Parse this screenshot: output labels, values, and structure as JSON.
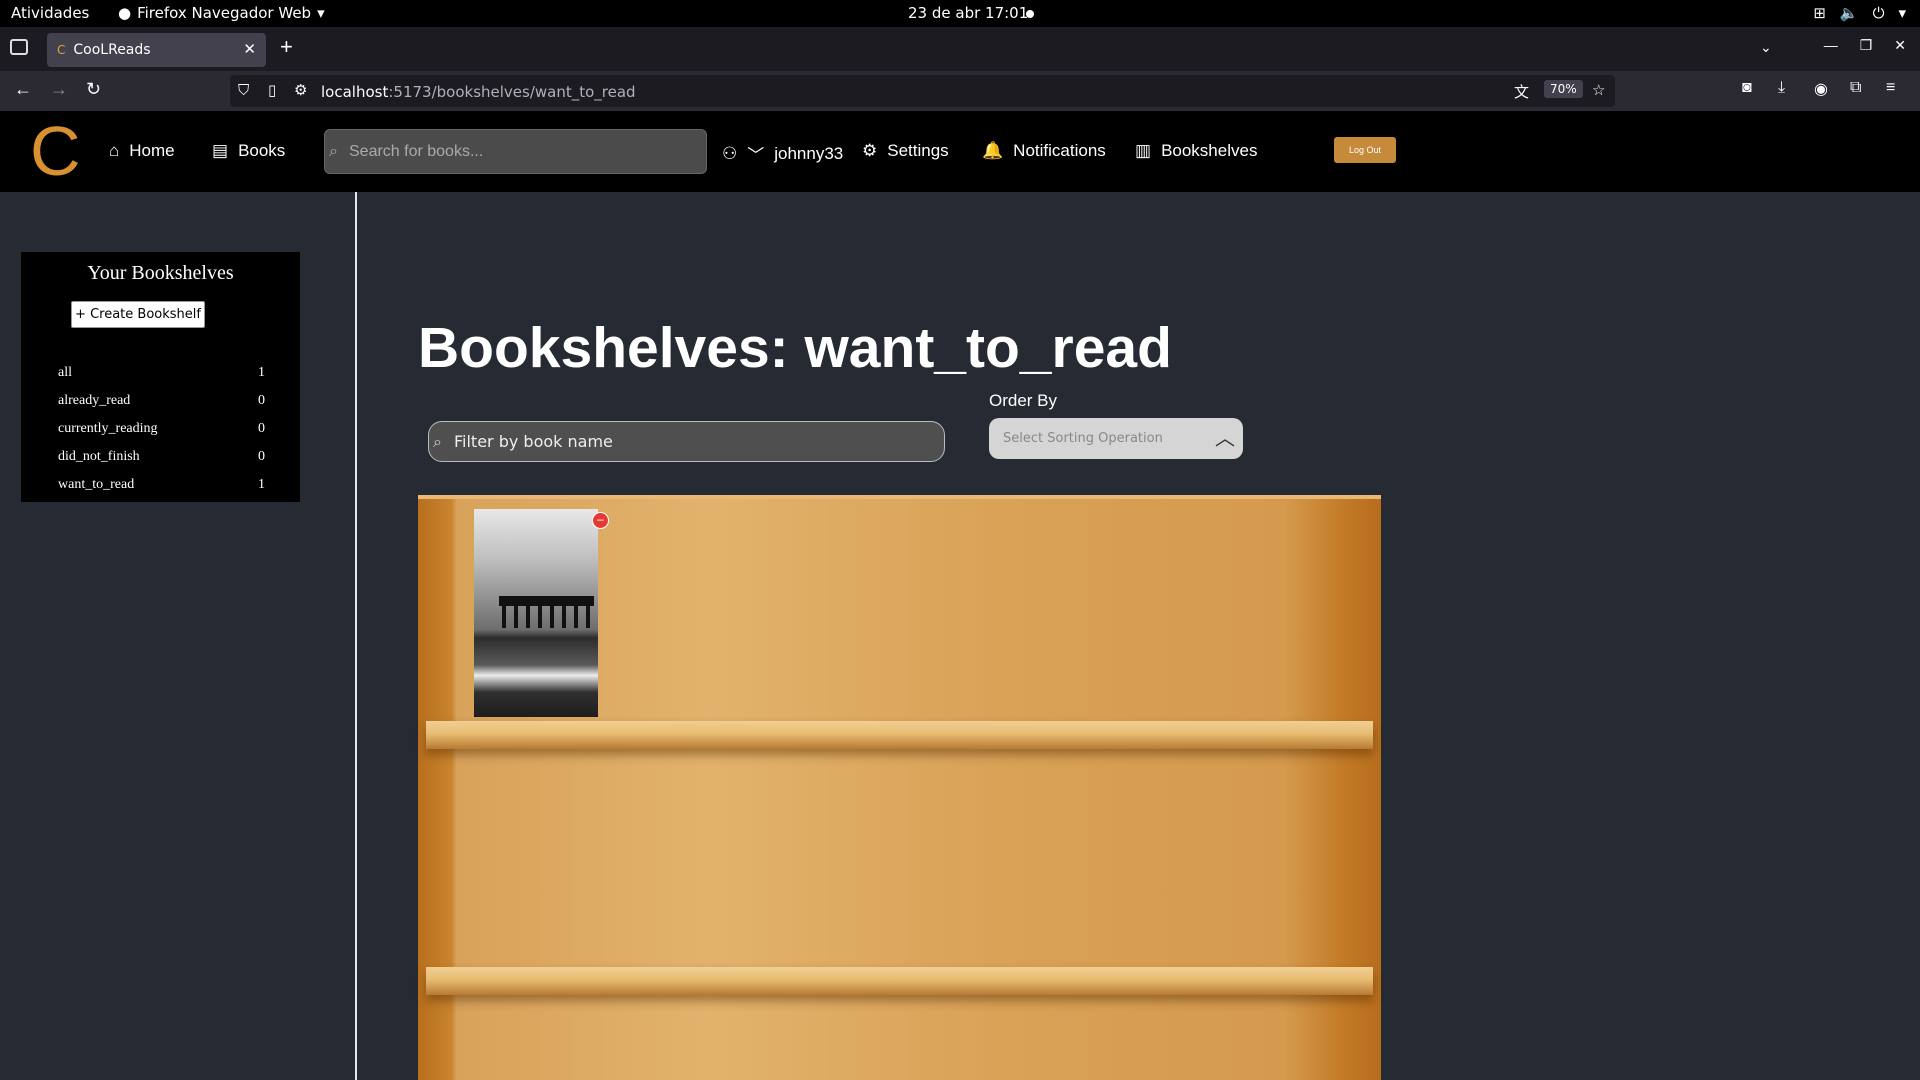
{
  "os_bar": {
    "activities": "Atividades",
    "app_name": "Firefox Navegador Web",
    "clock": "23 de abr  17:01"
  },
  "browser": {
    "tab_title": "CooLReads",
    "url_host": "localhost",
    "url_rest": ":5173/bookshelves/want_to_read",
    "zoom": "70%"
  },
  "header": {
    "logo": "C",
    "home": "Home",
    "books": "Books",
    "search_placeholder": "Search for books...",
    "username": "johnny33",
    "settings": "Settings",
    "notifications": "Notifications",
    "bookshelves": "Bookshelves",
    "logout": "Log Out"
  },
  "sidebar": {
    "title": "Your Bookshelves",
    "create_button": "+ Create Bookshelf",
    "shelves": [
      {
        "name": "all",
        "count": "1"
      },
      {
        "name": "already_read",
        "count": "0"
      },
      {
        "name": "currently_reading",
        "count": "0"
      },
      {
        "name": "did_not_finish",
        "count": "0"
      },
      {
        "name": "want_to_read",
        "count": "1"
      }
    ]
  },
  "main": {
    "page_title": "Bookshelves: want_to_read",
    "filter_placeholder": "Filter by book name",
    "order_by_label": "Order By",
    "sort_placeholder": "Select Sorting Operation"
  },
  "colors": {
    "accent": "#d99030",
    "background": "#252a33"
  }
}
